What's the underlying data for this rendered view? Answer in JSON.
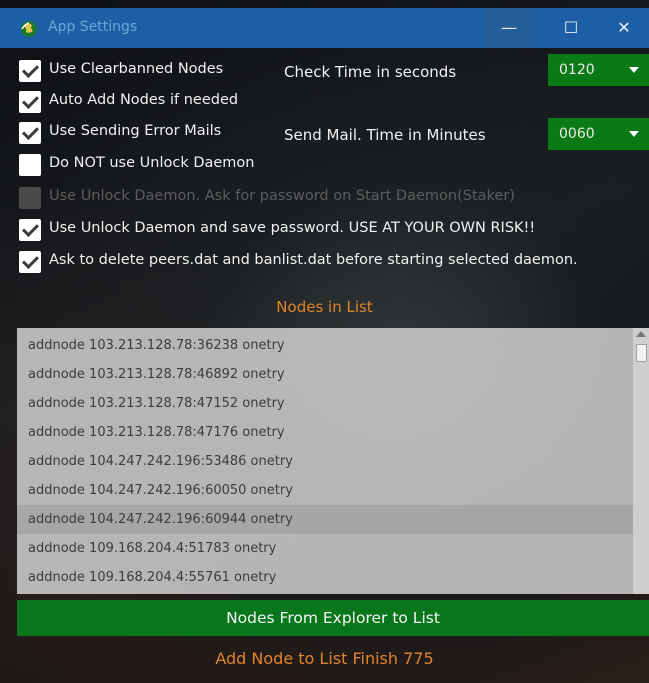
{
  "window": {
    "title": "App Settings",
    "minimize_glyph": "—",
    "maximize_glyph": "☐",
    "close_glyph": "✕",
    "title_bar_color": "#1c5fa6",
    "icon": "app-globe-icon"
  },
  "options": [
    {
      "label": "Use Clearbanned Nodes",
      "checked": true,
      "enabled": true
    },
    {
      "label": "Auto Add Nodes if needed",
      "checked": true,
      "enabled": true
    },
    {
      "label": "Use Sending Error Mails",
      "checked": true,
      "enabled": true
    },
    {
      "label": "Do NOT use Unlock Daemon",
      "checked": false,
      "enabled": true
    },
    {
      "label": "Use Unlock Daemon. Ask for password on Start Daemon(Staker)",
      "checked": false,
      "enabled": false
    },
    {
      "label": "Use Unlock Daemon and save password. USE AT YOUR OWN RISK!!",
      "checked": true,
      "enabled": true
    },
    {
      "label": "Ask to delete peers.dat and banlist.dat before starting selected daemon.",
      "checked": true,
      "enabled": true
    }
  ],
  "check_time": {
    "label": "Check Time in seconds",
    "value": "0120"
  },
  "send_mail": {
    "label": "Send Mail. Time in Minutes",
    "value": "0060"
  },
  "nodes": {
    "title": "Nodes in List",
    "items": [
      "addnode 103.213.128.78:36238 onetry",
      "addnode 103.213.128.78:46892 onetry",
      "addnode 103.213.128.78:47152 onetry",
      "addnode 103.213.128.78:47176 onetry",
      "addnode 104.247.242.196:53486 onetry",
      "addnode 104.247.242.196:60050 onetry",
      "addnode 104.247.242.196:60944 onetry",
      "addnode 109.168.204.4:51783 onetry",
      "addnode 109.168.204.4:55761 onetry"
    ],
    "selected_index": 6
  },
  "explorer_button": "Nodes From Explorer to List",
  "status": "Add Node to List Finish 775",
  "colors": {
    "accent_orange": "#e2832b",
    "button_green": "#08761a"
  }
}
